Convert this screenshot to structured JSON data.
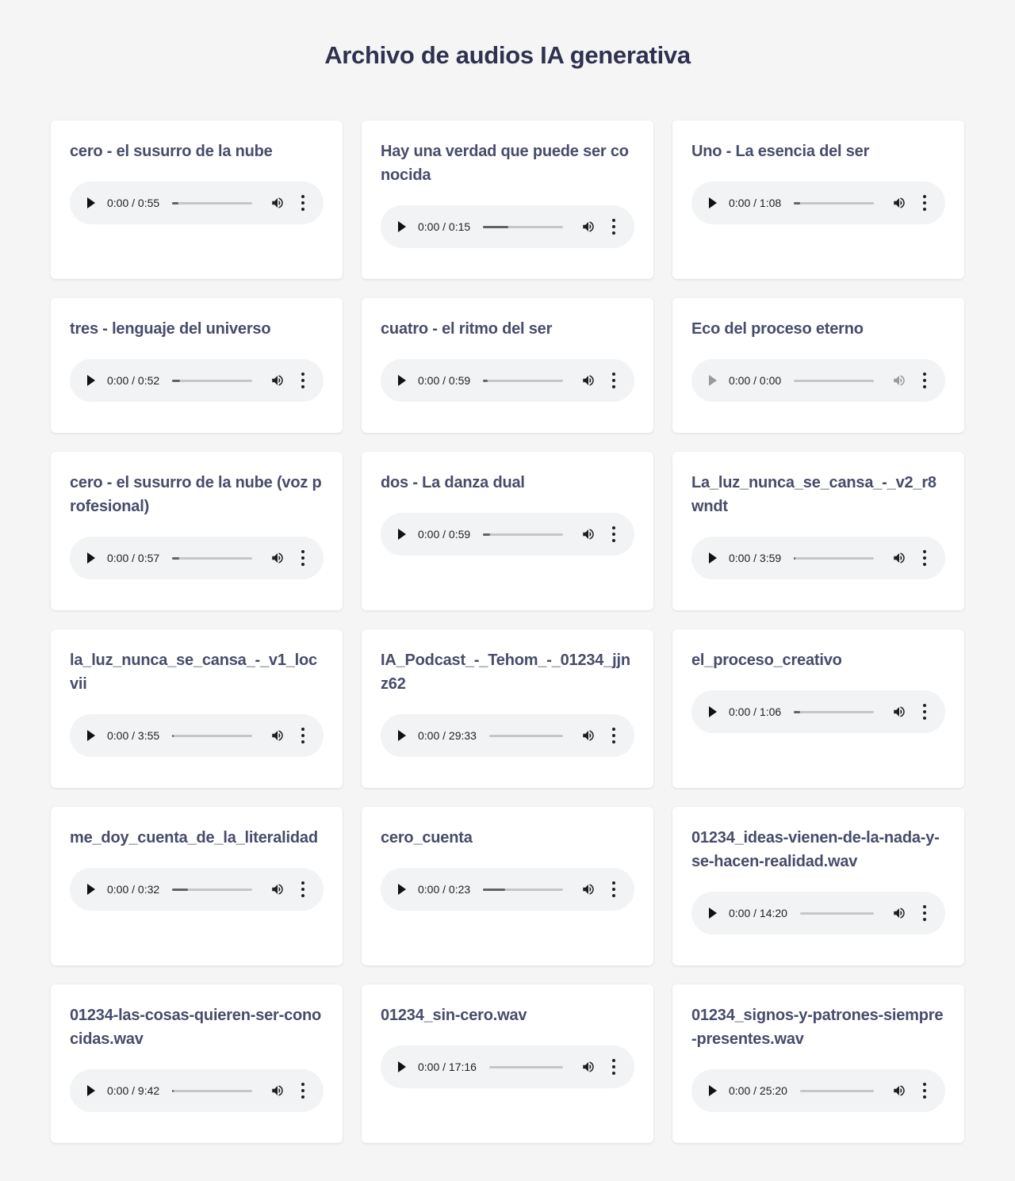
{
  "page": {
    "title": "Archivo de audios IA generativa"
  },
  "tracks": [
    {
      "title": "cero - el susurro de la nube",
      "time": "0:00 / 0:55",
      "buffered": 0.08,
      "disabled": false
    },
    {
      "title": "Hay una verdad que puede ser conocida",
      "time": "0:00 / 0:15",
      "buffered": 0.32,
      "disabled": false
    },
    {
      "title": "Uno - La esencia del ser",
      "time": "0:00 / 1:08",
      "buffered": 0.08,
      "disabled": false
    },
    {
      "title": "tres - lenguaje del universo",
      "time": "0:00 / 0:52",
      "buffered": 0.1,
      "disabled": false
    },
    {
      "title": "cuatro - el ritmo del ser",
      "time": "0:00 / 0:59",
      "buffered": 0.06,
      "disabled": false
    },
    {
      "title": "Eco del proceso eterno",
      "time": "0:00 / 0:00",
      "buffered": 0,
      "disabled": true
    },
    {
      "title": "cero - el susurro de la nube (voz profesional)",
      "time": "0:00 / 0:57",
      "buffered": 0.09,
      "disabled": false
    },
    {
      "title": "dos - La danza dual",
      "time": "0:00 / 0:59",
      "buffered": 0.09,
      "disabled": false
    },
    {
      "title": "La_luz_nunca_se_cansa_-_v2_r8wndt",
      "time": "0:00 / 3:59",
      "buffered": 0.02,
      "disabled": false
    },
    {
      "title": "la_luz_nunca_se_cansa_-_v1_locvii",
      "time": "0:00 / 3:55",
      "buffered": 0.02,
      "disabled": false
    },
    {
      "title": "IA_Podcast_-_Tehom_-_01234_jjnz62",
      "time": "0:00 / 29:33",
      "buffered": 0,
      "disabled": false
    },
    {
      "title": "el_proceso_creativo",
      "time": "0:00 / 1:06",
      "buffered": 0.08,
      "disabled": false
    },
    {
      "title": "me_doy_cuenta_de_la_literalidad",
      "time": "0:00 / 0:32",
      "buffered": 0.2,
      "disabled": false
    },
    {
      "title": "cero_cuenta",
      "time": "0:00 / 0:23",
      "buffered": 0.28,
      "disabled": false
    },
    {
      "title": "01234_ideas-vienen-de-la-nada-y-se-hacen-realidad.wav",
      "time": "0:00 / 14:20",
      "buffered": 0,
      "disabled": false
    },
    {
      "title": "01234-las-cosas-quieren-ser-conocidas.wav",
      "time": "0:00 / 9:42",
      "buffered": 0.02,
      "disabled": false
    },
    {
      "title": "01234_sin-cero.wav",
      "time": "0:00 / 17:16",
      "buffered": 0,
      "disabled": false
    },
    {
      "title": "01234_signos-y-patrones-siempre-presentes.wav",
      "time": "0:00 / 25:20",
      "buffered": 0,
      "disabled": false
    }
  ]
}
